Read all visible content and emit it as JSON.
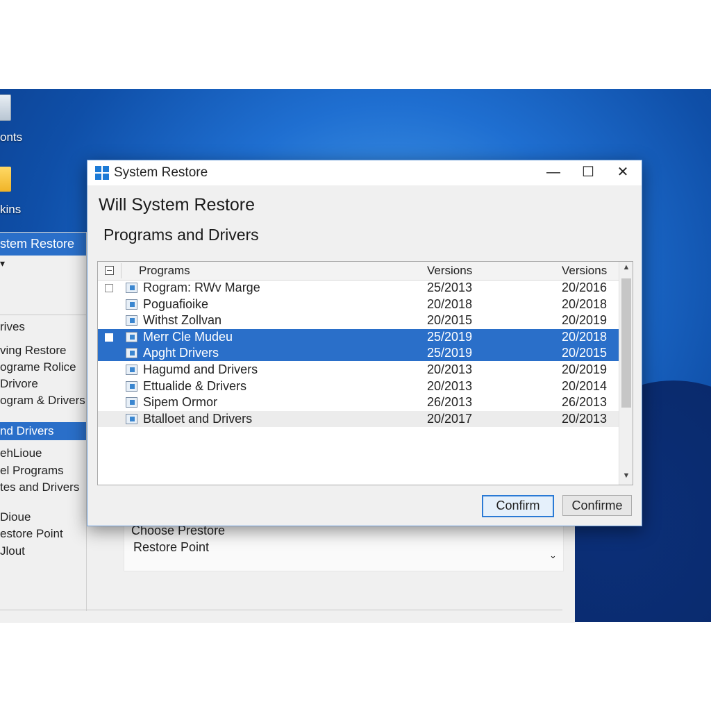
{
  "desktop": {
    "icons": [
      {
        "label": "onts",
        "icon": "recycle-bin-icon"
      },
      {
        "label": "kins",
        "icon": "folder-icon"
      }
    ]
  },
  "background_window": {
    "selected_top": "stem Restore",
    "chevron": "▾",
    "items": [
      "rives",
      "ving Restore",
      "ograme Rolice",
      "Drivore",
      "ogram & Drivers"
    ],
    "selected_mid": "nd Drivers",
    "items2": [
      "ehLioue",
      "el Programs",
      "tes and Drivers",
      "Dioue",
      "estore Point",
      "Jlout"
    ],
    "panel": {
      "line1": "Choose Prestore",
      "line2": "Restore Point"
    }
  },
  "dialog": {
    "title": "System Restore",
    "controls": {
      "minimize": "—",
      "maximize": "☐",
      "close": "✕"
    },
    "heading": "Will System Restore",
    "subheading": "Programs and Drivers",
    "columns": [
      "Programs",
      "Versions",
      "Versions"
    ],
    "rows": [
      {
        "name": "Rogram: RWv Marge",
        "v1": "25/2013",
        "v2": "20/2016",
        "checkbox": true,
        "selected": false
      },
      {
        "name": "Poguafioike",
        "v1": "20/2018",
        "v2": "20/2018",
        "checkbox": false,
        "selected": false
      },
      {
        "name": "Withst Zollvan",
        "v1": "20/2015",
        "v2": "20/2019",
        "checkbox": false,
        "selected": false
      },
      {
        "name": "Merr Cle Mudeu",
        "v1": "25/2019",
        "v2": "20/2018",
        "checkbox": true,
        "selected": true
      },
      {
        "name": "Apght Drivers",
        "v1": "25/2019",
        "v2": "20/2015",
        "checkbox": false,
        "selected": true
      },
      {
        "name": "Hagumd and Drivers",
        "v1": "20/2013",
        "v2": "20/2019",
        "checkbox": false,
        "selected": false
      },
      {
        "name": "Ettualide & Drivers",
        "v1": "20/2013",
        "v2": "20/2014",
        "checkbox": false,
        "selected": false
      },
      {
        "name": "Sipem Ormor",
        "v1": "26/2013",
        "v2": "26/2013",
        "checkbox": false,
        "selected": false
      },
      {
        "name": "Btalloet and Drivers",
        "v1": "20/2017",
        "v2": "20/2013",
        "checkbox": false,
        "selected": false,
        "shaded": true
      }
    ],
    "buttons": {
      "confirm": "Confirm",
      "confirme": "Confirme"
    }
  },
  "colors": {
    "accent": "#2a6fc9",
    "desktop": "#1f6fd1"
  }
}
